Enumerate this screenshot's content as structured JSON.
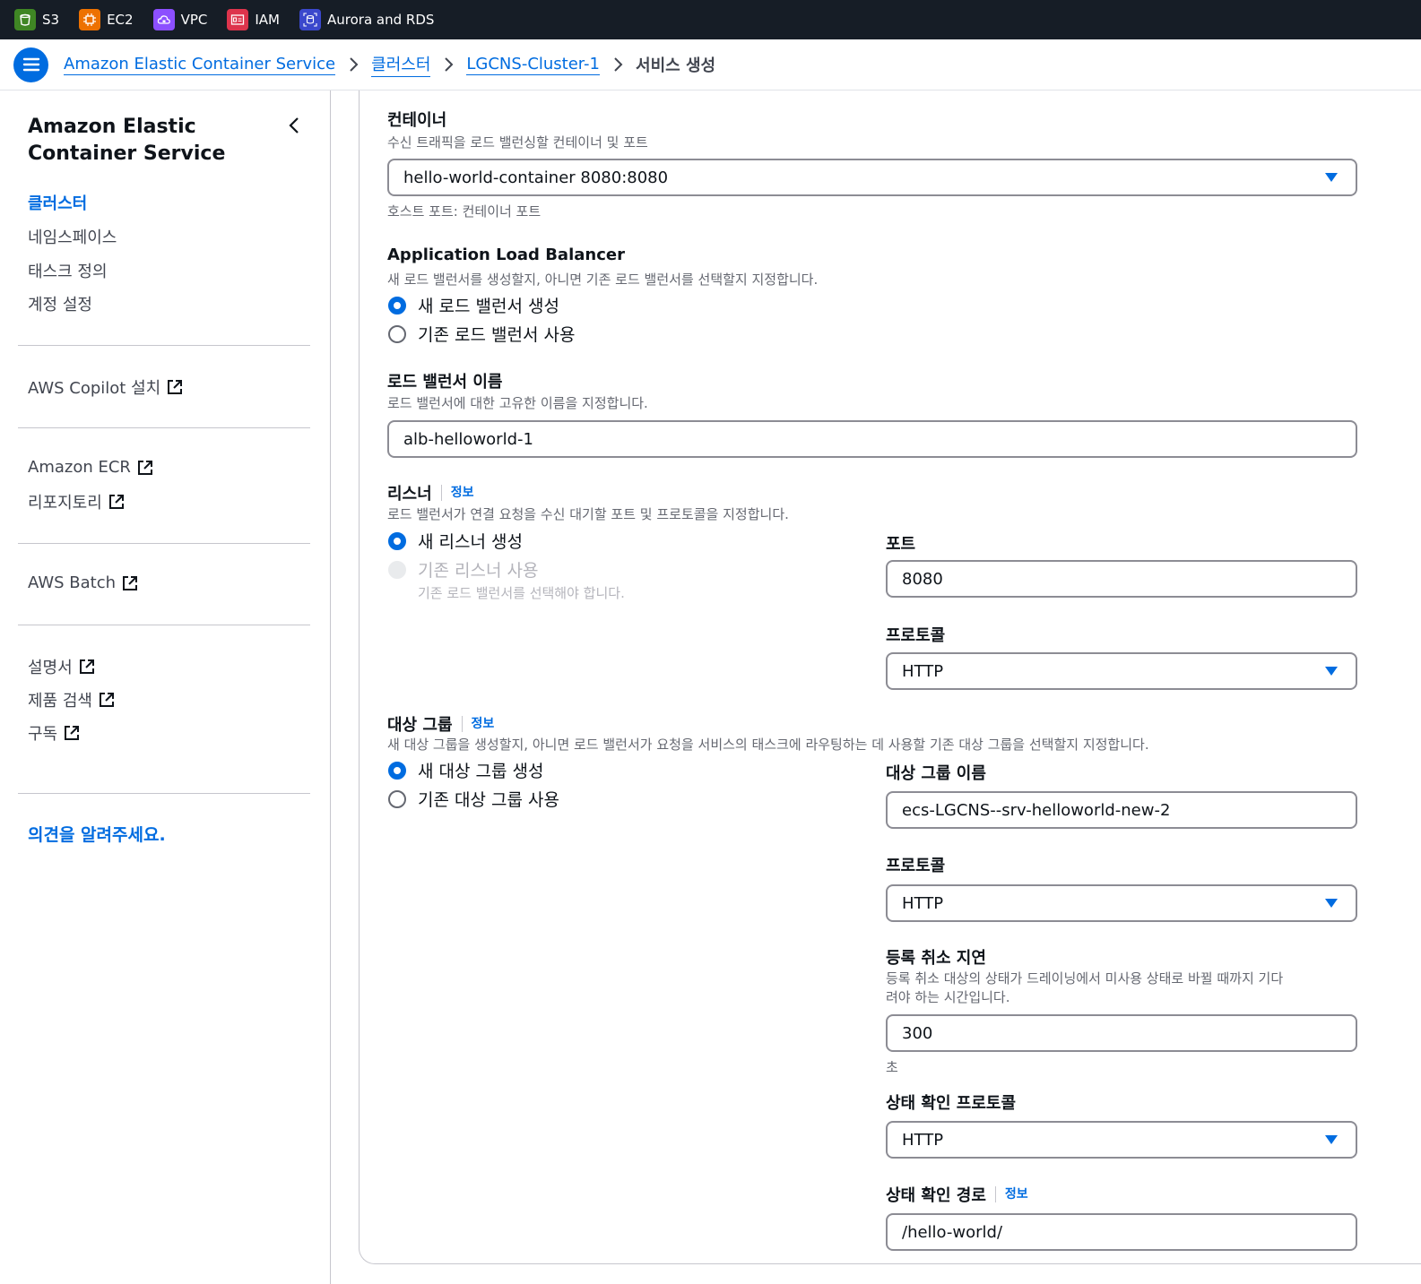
{
  "topnav": {
    "services": [
      {
        "label": "S3",
        "icon": "s3-bucket-icon",
        "color": "#3f8624"
      },
      {
        "label": "EC2",
        "icon": "ec2-chip-icon",
        "color": "#ed7100"
      },
      {
        "label": "VPC",
        "icon": "vpc-cloud-icon",
        "color": "#8c4fff"
      },
      {
        "label": "IAM",
        "icon": "iam-badge-icon",
        "color": "#dd344c"
      },
      {
        "label": "Aurora and RDS",
        "icon": "rds-database-icon",
        "color": "#3b48cc"
      }
    ]
  },
  "breadcrumb": {
    "items": [
      "Amazon Elastic Container Service",
      "클러스터",
      "LGCNS-Cluster-1"
    ],
    "current": "서비스 생성"
  },
  "sidebar": {
    "title": "Amazon Elastic Container Service",
    "nav": [
      "클러스터",
      "네임스페이스",
      "태스크 정의",
      "계정 설정"
    ],
    "links": {
      "copilot": "AWS Copilot 설치",
      "ecr": "Amazon ECR",
      "repos": "리포지토리",
      "batch": "AWS Batch",
      "docs": "설명서",
      "product_search": "제품 검색",
      "subscribe": "구독"
    },
    "feedback": "의견을 알려주세요."
  },
  "form": {
    "container": {
      "label": "컨테이너",
      "description": "수신 트래픽을 로드 밸런싱할 컨테이너 및 포트",
      "value": "hello-world-container 8080:8080",
      "hint": "호스트 포트: 컨테이너 포트"
    },
    "alb": {
      "label": "Application Load Balancer",
      "description": "새 로드 밸런서를 생성할지, 아니면 기존 로드 밸런서를 선택할지 지정합니다.",
      "option_new": "새 로드 밸런서 생성",
      "option_existing": "기존 로드 밸런서 사용"
    },
    "lb_name": {
      "label": "로드 밸런서 이름",
      "description": "로드 밸런서에 대한 고유한 이름을 지정합니다.",
      "value": "alb-helloworld-1"
    },
    "listener": {
      "label": "리스너",
      "info": "정보",
      "description": "로드 밸런서가 연결 요청을 수신 대기할 포트 및 프로토콜을 지정합니다.",
      "option_new": "새 리스너 생성",
      "option_existing": "기존 리스너 사용",
      "option_existing_hint": "기존 로드 밸런서를 선택해야 합니다.",
      "port_label": "포트",
      "port_value": "8080",
      "protocol_label": "프로토콜",
      "protocol_value": "HTTP"
    },
    "target_group": {
      "label": "대상 그룹",
      "info": "정보",
      "description": "새 대상 그룹을 생성할지, 아니면 로드 밸런서가 요청을 서비스의 태스크에 라우팅하는 데 사용할 기존 대상 그룹을 선택할지 지정합니다.",
      "option_new": "새 대상 그룹 생성",
      "option_existing": "기존 대상 그룹 사용",
      "name_label": "대상 그룹 이름",
      "name_value": "ecs-LGCNS--srv-helloworld-new-2",
      "protocol_label": "프로토콜",
      "protocol_value": "HTTP",
      "dereg_label": "등록 취소 지연",
      "dereg_description_1": "등록 취소 대상의 상태가 드레이닝에서 미사용 상태로 바뀔 때까지 기다",
      "dereg_description_2": "려야 하는 시간입니다.",
      "dereg_value": "300",
      "dereg_unit": "초",
      "hc_protocol_label": "상태 확인 프로토콜",
      "hc_protocol_value": "HTTP",
      "hc_path_label": "상태 확인 경로",
      "hc_path_info": "정보",
      "hc_path_value": "/hello-world/"
    }
  },
  "colors": {
    "accent": "#006ce0",
    "topbar": "#161d26",
    "border": "#8c8c94"
  }
}
